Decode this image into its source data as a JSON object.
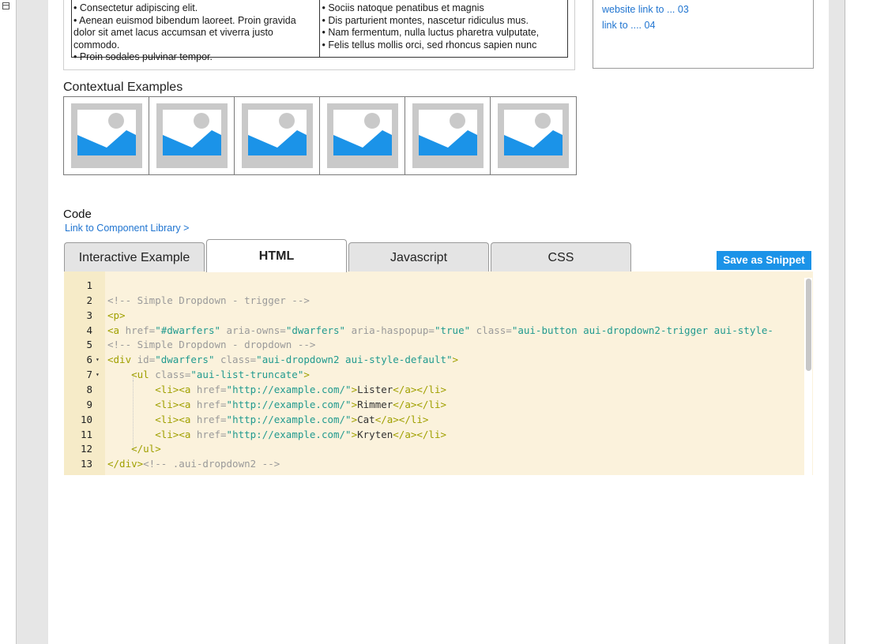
{
  "info_table": {
    "left_items": [
      "• Consectetur adipiscing elit.",
      "• Aenean euismod bibendum laoreet. Proin gravida dolor sit amet lacus accumsan et viverra justo commodo.",
      "• Proin sodales pulvinar tempor."
    ],
    "right_items": [
      "• Sociis natoque penatibus et magnis",
      "• Dis parturient montes, nascetur ridiculus mus.",
      "• Nam fermentum, nulla luctus pharetra vulputate,",
      "• Felis tellus mollis orci, sed rhoncus sapien nunc"
    ]
  },
  "links": [
    "website link to ... 03",
    "link to .... 04"
  ],
  "contextual": {
    "title": "Contextual Examples",
    "thumb_count": 6
  },
  "code_section": {
    "title": "Code",
    "library_link": "Link to Component Library >",
    "tabs": [
      {
        "label": "Interactive Example",
        "active": false
      },
      {
        "label": "HTML",
        "active": true
      },
      {
        "label": "Javascript",
        "active": false
      },
      {
        "label": "CSS",
        "active": false
      }
    ],
    "save_button": "Save as Snippet"
  },
  "editor": {
    "lines": [
      {
        "n": "1",
        "fold": "",
        "tokens": []
      },
      {
        "n": "2",
        "fold": "",
        "tokens": [
          [
            "com",
            "<!-- Simple Dropdown - trigger -->"
          ]
        ]
      },
      {
        "n": "3",
        "fold": "",
        "tokens": [
          [
            "tag",
            "<p>"
          ]
        ]
      },
      {
        "n": "4",
        "fold": "",
        "tokens": [
          [
            "tag",
            "<a "
          ],
          [
            "attr",
            "href="
          ],
          [
            "str",
            "\"#dwarfers\""
          ],
          [
            "attr",
            " aria-owns="
          ],
          [
            "str",
            "\"dwarfers\""
          ],
          [
            "attr",
            " aria-haspopup="
          ],
          [
            "str",
            "\"true\""
          ],
          [
            "attr",
            " class="
          ],
          [
            "str",
            "\"aui-button aui-dropdown2-trigger aui-style-"
          ]
        ]
      },
      {
        "n": "5",
        "fold": "",
        "tokens": [
          [
            "com",
            "<!-- Simple Dropdown - dropdown -->"
          ]
        ]
      },
      {
        "n": "6",
        "fold": "▾",
        "tokens": [
          [
            "tag",
            "<div "
          ],
          [
            "attr",
            "id="
          ],
          [
            "str",
            "\"dwarfers\""
          ],
          [
            "attr",
            " class="
          ],
          [
            "str",
            "\"aui-dropdown2 aui-style-default\""
          ],
          [
            "tag",
            ">"
          ]
        ]
      },
      {
        "n": "7",
        "fold": "▾",
        "tokens": [
          [
            "txt",
            "    "
          ],
          [
            "tag",
            "<ul "
          ],
          [
            "attr",
            "class="
          ],
          [
            "str",
            "\"aui-list-truncate\""
          ],
          [
            "tag",
            ">"
          ]
        ]
      },
      {
        "n": "8",
        "fold": "",
        "tokens": [
          [
            "txt",
            "        "
          ],
          [
            "tag",
            "<li><a "
          ],
          [
            "attr",
            "href="
          ],
          [
            "str",
            "\"http://example.com/\""
          ],
          [
            "tag",
            ">"
          ],
          [
            "txt",
            "Lister"
          ],
          [
            "tag",
            "</a></li>"
          ]
        ]
      },
      {
        "n": "9",
        "fold": "",
        "tokens": [
          [
            "txt",
            "        "
          ],
          [
            "tag",
            "<li><a "
          ],
          [
            "attr",
            "href="
          ],
          [
            "str",
            "\"http://example.com/\""
          ],
          [
            "tag",
            ">"
          ],
          [
            "txt",
            "Rimmer"
          ],
          [
            "tag",
            "</a></li>"
          ]
        ]
      },
      {
        "n": "10",
        "fold": "",
        "tokens": [
          [
            "txt",
            "        "
          ],
          [
            "tag",
            "<li><a "
          ],
          [
            "attr",
            "href="
          ],
          [
            "str",
            "\"http://example.com/\""
          ],
          [
            "tag",
            ">"
          ],
          [
            "txt",
            "Cat"
          ],
          [
            "tag",
            "</a></li>"
          ]
        ]
      },
      {
        "n": "11",
        "fold": "",
        "tokens": [
          [
            "txt",
            "        "
          ],
          [
            "tag",
            "<li><a "
          ],
          [
            "attr",
            "href="
          ],
          [
            "str",
            "\"http://example.com/\""
          ],
          [
            "tag",
            ">"
          ],
          [
            "txt",
            "Kryten"
          ],
          [
            "tag",
            "</a></li>"
          ]
        ]
      },
      {
        "n": "12",
        "fold": "",
        "tokens": [
          [
            "txt",
            "    "
          ],
          [
            "tag",
            "</ul>"
          ]
        ]
      },
      {
        "n": "13",
        "fold": "",
        "tokens": [
          [
            "tag",
            "</div>"
          ],
          [
            "com",
            "<!-- .aui-dropdown2 -->"
          ]
        ]
      }
    ]
  },
  "colors": {
    "link": "#1f74d0",
    "button": "#1b93e8",
    "editor_bg": "#fbf2dc",
    "editor_gutter": "#f6ebc8",
    "thumb_sky": "#1b93e8",
    "thumb_frame": "#c9c9c9"
  }
}
